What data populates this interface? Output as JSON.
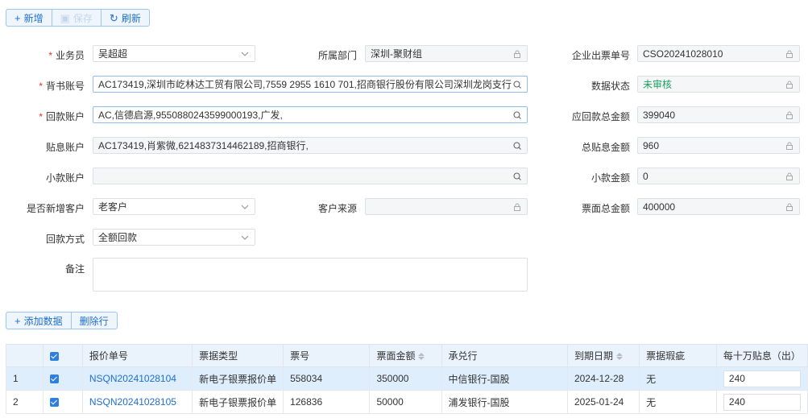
{
  "toolbar": {
    "add_label": "新增",
    "save_label": "保存",
    "refresh_label": "刷新"
  },
  "form": {
    "salesperson": {
      "label": "业务员",
      "value": "吴超超"
    },
    "department": {
      "label": "所属部门",
      "value": "深圳-聚财组"
    },
    "ticket_no": {
      "label": "企业出票单号",
      "value": "CSO20241028010"
    },
    "endorse_account": {
      "label": "背书账号",
      "value": "AC173419,深圳市屹林达工贸有限公司,7559 2955 1610 701,招商银行股份有限公司深圳龙岗支行,"
    },
    "data_status": {
      "label": "数据状态",
      "value": "未审核"
    },
    "repay_account": {
      "label": "回款账户",
      "value": "AC,信德启源,9550880243599000193,广发,"
    },
    "receivable_total": {
      "label": "应回款总金额",
      "value": "399040"
    },
    "discount_account": {
      "label": "贴息账户",
      "value": "AC173419,肖紫微,6214837314462189,招商银行,"
    },
    "discount_total": {
      "label": "总贴息金额",
      "value": "960"
    },
    "small_account": {
      "label": "小款账户",
      "value": ""
    },
    "small_amount": {
      "label": "小款金额",
      "value": "0"
    },
    "new_customer": {
      "label": "是否新增客户",
      "value": "老客户"
    },
    "customer_source": {
      "label": "客户来源",
      "value": ""
    },
    "face_total": {
      "label": "票面总金额",
      "value": "400000"
    },
    "repay_method": {
      "label": "回款方式",
      "value": "全额回款"
    },
    "remark": {
      "label": "备注",
      "value": ""
    }
  },
  "table_toolbar": {
    "add_data_label": "添加数据",
    "delete_row_label": "删除行"
  },
  "table": {
    "headers": [
      "报价单号",
      "票据类型",
      "票号",
      "票面金额",
      "承兑行",
      "到期日期",
      "票据瑕疵",
      "每十万贴息（出）"
    ],
    "rows": [
      {
        "idx": "1",
        "quote_no": "NSQN20241028104",
        "type": "新电子银票报价单",
        "ticket": "558034",
        "amount": "350000",
        "bank": "中信银行-国股",
        "due": "2024-12-28",
        "flaw": "无",
        "interest": "240"
      },
      {
        "idx": "2",
        "quote_no": "NSQN20241028105",
        "type": "新电子银票报价单",
        "ticket": "126836",
        "amount": "50000",
        "bank": "浦发银行-国股",
        "due": "2025-01-24",
        "flaw": "无",
        "interest": "240"
      }
    ]
  },
  "colors": {
    "accent": "#1f6fd0",
    "status_green": "#19a15f",
    "required": "#e0302a"
  }
}
